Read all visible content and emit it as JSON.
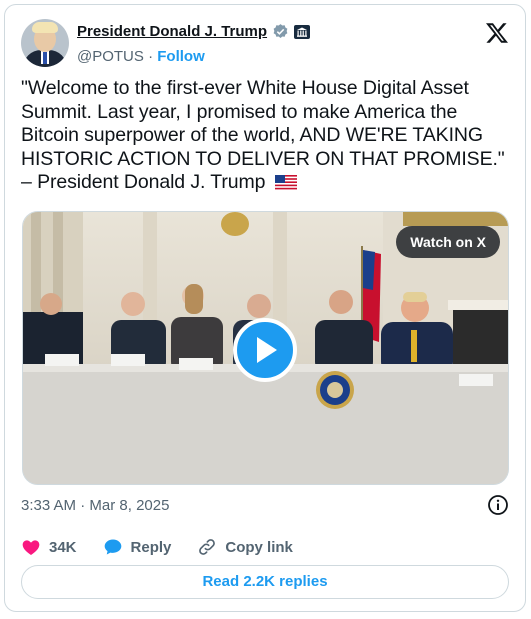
{
  "author": {
    "display_name": "President Donald J. Trump",
    "handle": "@POTUS",
    "separator": " · ",
    "follow_label": "Follow"
  },
  "icons": {
    "verified": "verified-badge-icon",
    "government": "white-house-icon",
    "platform": "x-logo-icon",
    "flag": "us-flag-icon",
    "info": "info-icon",
    "like": "heart-icon",
    "reply": "speech-bubble-icon",
    "copy_link": "link-icon",
    "play": "play-icon"
  },
  "colors": {
    "accent": "#1d9bf0",
    "like": "#f91880",
    "text": "#0f1419",
    "muted": "#536471"
  },
  "tweet": {
    "text": "\"Welcome to the first-ever White House Digital Asset Summit. Last year, I promised to make America the Bitcoin superpower of the world, AND WE'RE TAKING HISTORIC ACTION TO DELIVER ON THAT PROMISE.\" – President Donald J. Trump"
  },
  "media": {
    "watch_label": "Watch on X"
  },
  "meta": {
    "time": "3:33 AM",
    "separator": " · ",
    "date": "Mar 8, 2025"
  },
  "actions": {
    "like_count": "34K",
    "reply_label": "Reply",
    "copy_link_label": "Copy link"
  },
  "footer": {
    "read_replies_label": "Read 2.2K replies"
  }
}
